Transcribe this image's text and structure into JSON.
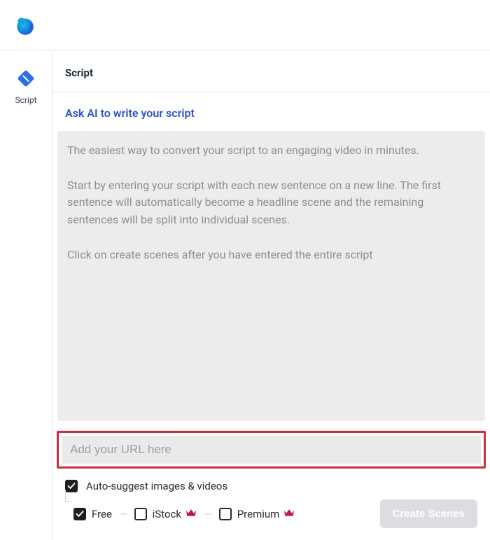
{
  "sidebar": {
    "items": [
      {
        "label": "Script"
      }
    ]
  },
  "header": {
    "section_title": "Script",
    "ask_ai": "Ask AI to write your script"
  },
  "script": {
    "placeholder": "The easiest way to convert your script to an engaging video in minutes.\n\nStart by entering your script with each new sentence on a new line. The first sentence will automatically become a headline scene and the remaining sentences will be split into individual scenes.\n\nClick on create scenes after you have entered the entire script"
  },
  "url": {
    "placeholder": "Add your URL here",
    "value": ""
  },
  "options": {
    "auto_suggest_label": "Auto-suggest images & videos",
    "auto_suggest_checked": true,
    "free": {
      "label": "Free",
      "checked": true
    },
    "istock": {
      "label": "iStock",
      "checked": false
    },
    "premium": {
      "label": "Premium",
      "checked": false
    }
  },
  "create_button": "Create Scenes"
}
